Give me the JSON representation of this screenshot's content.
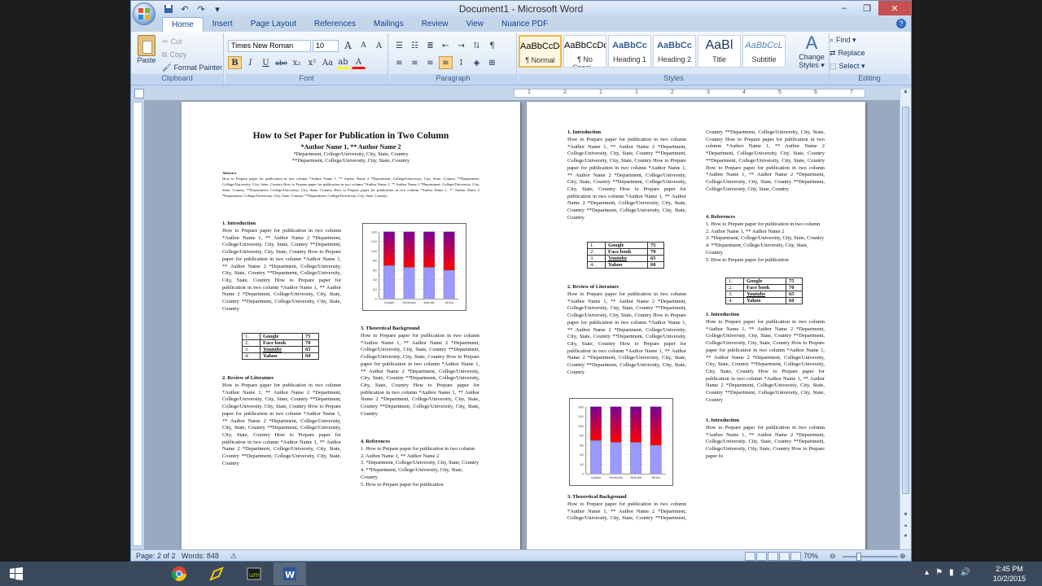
{
  "window": {
    "title": "Document1 - Microsoft Word",
    "controls": {
      "minimize": "‒",
      "maximize": "❐",
      "close": "✕"
    }
  },
  "qat": {
    "save_icon": "save-icon",
    "undo_icon": "undo-icon",
    "redo_icon": "redo-icon",
    "customize_icon": "customize-qat-icon"
  },
  "tabs": [
    {
      "label": "Home",
      "active": true
    },
    {
      "label": "Insert"
    },
    {
      "label": "Page Layout"
    },
    {
      "label": "References"
    },
    {
      "label": "Mailings"
    },
    {
      "label": "Review"
    },
    {
      "label": "View"
    },
    {
      "label": "Nuance PDF"
    }
  ],
  "help": "?",
  "clipboard": {
    "paste": "Paste",
    "cut": "Cut",
    "copy": "Copy",
    "format_painter": "Format Painter",
    "label": "Clipboard"
  },
  "font": {
    "name": "Times New Roman",
    "size": "10",
    "label": "Font",
    "grow": "A",
    "shrink": "A",
    "clear": "A",
    "bold": "B",
    "italic": "I",
    "underline": "U",
    "strike": "abe",
    "sub": "x₂",
    "sup": "x²",
    "case": "Aa",
    "highlight": "ab",
    "color": "A"
  },
  "paragraph": {
    "label": "Paragraph",
    "pilcrow": "¶"
  },
  "styles": {
    "label": "Styles",
    "items": [
      {
        "preview": "AaBbCcDc",
        "name": "¶ Normal",
        "selected": true
      },
      {
        "preview": "AaBbCcDc",
        "name": "¶ No Spaci..."
      },
      {
        "preview": "AaBbCc",
        "name": "Heading 1"
      },
      {
        "preview": "AaBbCc",
        "name": "Heading 2"
      },
      {
        "preview": "AaBl",
        "name": "Title"
      },
      {
        "preview": "AaBbCcL",
        "name": "Subtitle"
      }
    ],
    "change_line1": "Change",
    "change_line2": "Styles ▾"
  },
  "editing": {
    "label": "Editing",
    "find": "Find ▾",
    "replace": "Replace",
    "select": "Select ▾"
  },
  "ruler_marks": [
    "1",
    "2",
    "1",
    "1",
    "2",
    "3",
    "4",
    "5",
    "6",
    "7"
  ],
  "doc": {
    "title": "How to Set Paper for Publication in Two Column",
    "authors": "*Author Name 1, ** Author Name 2",
    "affil1": "*Department, College/University, City, State, Country",
    "affil2": "**Department, College/University, City, State, Country",
    "abstract_head": "Abstract",
    "abstract": "How to Prepare paper for publication in two column *Author Name 1, ** Author Name 2 *Department, College/University, City, State, Country **Department, College/University, City, State, Country How to Prepare paper for publication in two column *Author Name 1, ** Author Name 2 *Department, College/University, City, State, Country **Department, College/University, City, State, Country How to Prepare paper for publication in two column *Author Name 1, ** Author Name 2 *Department, College/University, City, State, Country **Department, College/University, City, State, Country",
    "intro_head": "1.        Introduction",
    "review_head": "2.        Review of Literature",
    "theory_head": "3.        Theoretical Background",
    "refs_head": "4.        References",
    "body": "How to Prepare paper for publication in two column *Author Name 1, ** Author Name 2 *Department, College/University, City, State, Country **Department, College/University, City, State, Country How to Prepare paper for publication in two column *Author Name 1, ** Author Name 2 *Department, College/University, City, State, Country **Department, College/University, City, State, Country How to Prepare paper for publication in two column *Author Name 1, ** Author Name 2 *Department, College/University, City, State, Country **Department, College/University, City, State, Country",
    "body_short": "How to Prepare paper for publication in two column *Author Name 1, ** Author Name 2 *Department, College/University, City, State, Country **Department, College/University, City, State, Country How to Prepare paper fo",
    "col4_top": "Country **Department, College/University, City, State, Country How to Prepare paper for publication in two column *Author Name 1, ** Author Name 2 *Department, College/University, City, State, Country **Department, College/University, City, State, Country How to Prepare paper for publication in two column *Author Name 1, ** Author Name 2 *Department, College/University, City, State, Country **Department, College/University, City, State, Country",
    "refs": [
      "1. How to Prepare paper for publication in two column",
      "2. Author Name 1, ** Author Name 2",
      "3.  *Department, College/University, City, State, Country",
      "4.  **Department, College/University, City, State, Country",
      "5. How to Prepare paper for publication"
    ],
    "table": [
      [
        "1.",
        "Google",
        "75"
      ],
      [
        "2.",
        "Face book",
        "70"
      ],
      [
        "3.",
        "Youtube",
        "65"
      ],
      [
        "4.",
        "Yahoo",
        "60"
      ]
    ]
  },
  "chart_data": {
    "type": "bar",
    "categories": [
      "Google",
      "Facebook",
      "Youtube",
      "Yahoo"
    ],
    "series": [
      {
        "values": [
          70,
          66,
          66,
          60
        ]
      },
      {
        "values": [
          70,
          74,
          74,
          80
        ]
      }
    ],
    "stacked": true,
    "ylim": [
      0,
      140
    ],
    "yticks": [
      "0",
      "20",
      "40",
      "60",
      "80",
      "100",
      "120",
      "140"
    ],
    "colors": [
      "#9999ff",
      "#ff0000",
      "#7a0099"
    ]
  },
  "status": {
    "page": "Page: 2 of 2",
    "words": "Words: 848",
    "zoom": "70%"
  },
  "taskbar": {
    "time": "2:45 PM",
    "date": "10/2/2015"
  }
}
